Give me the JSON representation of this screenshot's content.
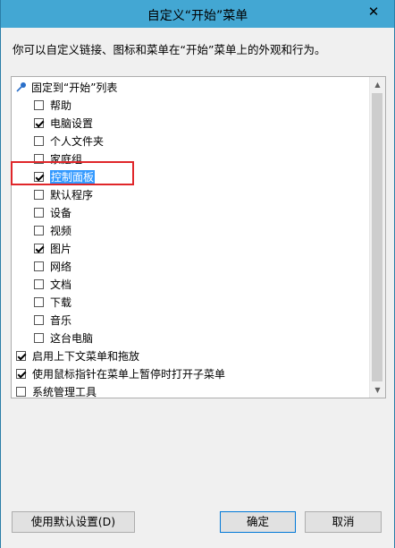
{
  "window": {
    "title": "自定义“开始”菜单",
    "close_symbol": "✕"
  },
  "description": "你可以自定义链接、图标和菜单在“开始”菜单上的外观和行为。",
  "list": {
    "header": "固定到“开始”列表",
    "items": [
      {
        "label": "帮助",
        "checked": false
      },
      {
        "label": "电脑设置",
        "checked": true
      },
      {
        "label": "个人文件夹",
        "checked": false
      },
      {
        "label": "家庭组",
        "checked": false
      },
      {
        "label": "控制面板",
        "checked": true,
        "selected": true
      },
      {
        "label": "默认程序",
        "checked": false
      },
      {
        "label": "设备",
        "checked": false
      },
      {
        "label": "视频",
        "checked": false
      },
      {
        "label": "图片",
        "checked": true
      },
      {
        "label": "网络",
        "checked": false
      },
      {
        "label": "文档",
        "checked": false
      },
      {
        "label": "下载",
        "checked": false
      },
      {
        "label": "音乐",
        "checked": false
      },
      {
        "label": "这台电脑",
        "checked": false
      }
    ],
    "options": [
      {
        "label": "启用上下文菜单和拖放",
        "checked": true
      },
      {
        "label": "使用鼠标指针在菜单上暂停时打开子菜单",
        "checked": true
      },
      {
        "label": "系统管理工具",
        "checked": false
      }
    ]
  },
  "buttons": {
    "defaults": "使用默认设置(D)",
    "ok": "确定",
    "cancel": "取消"
  },
  "colors": {
    "titlebar": "#43a7d3",
    "selection": "#3399ff",
    "annotation": "#e0262a"
  }
}
